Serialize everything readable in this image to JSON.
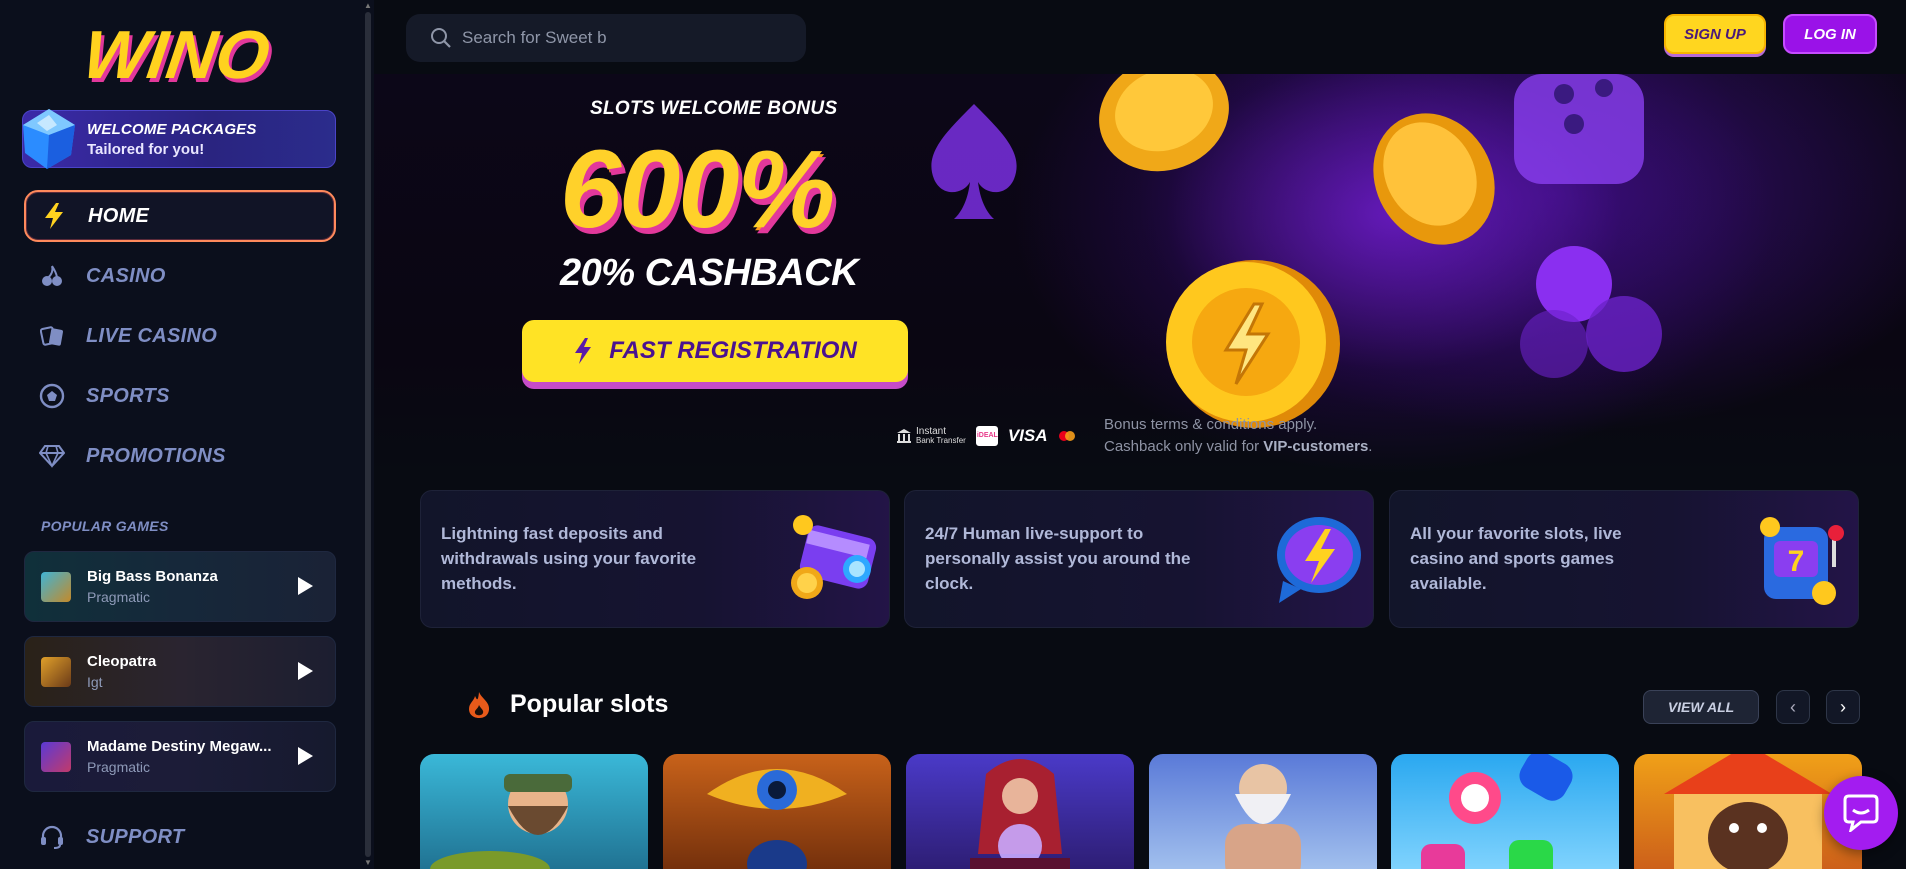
{
  "brand": {
    "logo_text": "WINO"
  },
  "sidebar": {
    "welcome": {
      "title": "WELCOME PACKAGES",
      "subtitle": "Tailored for you!"
    },
    "nav": [
      {
        "label": "HOME",
        "icon": "lightning-icon",
        "active": true
      },
      {
        "label": "CASINO",
        "icon": "cherries-icon",
        "active": false
      },
      {
        "label": "LIVE CASINO",
        "icon": "cards-icon",
        "active": false
      },
      {
        "label": "SPORTS",
        "icon": "soccer-ball-icon",
        "active": false
      },
      {
        "label": "PROMOTIONS",
        "icon": "diamond-icon",
        "active": false
      }
    ],
    "popular_title": "POPULAR GAMES",
    "games": [
      {
        "name": "Big Bass Bonanza",
        "provider": "Pragmatic"
      },
      {
        "name": "Cleopatra",
        "provider": "Igt"
      },
      {
        "name": "Madame Destiny Megaw...",
        "provider": "Pragmatic"
      }
    ],
    "support": {
      "label": "SUPPORT",
      "icon": "headset-icon"
    }
  },
  "header": {
    "search": {
      "prefix": "Search for",
      "value": "Sweet b",
      "icon": "search-icon"
    },
    "signup_label": "SIGN UP",
    "login_label": "LOG IN"
  },
  "hero": {
    "kicker": "SLOTS WELCOME BONUS",
    "headline": "600%",
    "cashback": "20% CASHBACK",
    "cta_label": "FAST REGISTRATION",
    "payments": {
      "bank_line1": "Instant",
      "bank_line2": "Bank Transfer",
      "ideal": "iDEAL",
      "visa": "VISA"
    },
    "terms_line1": "Bonus terms & conditions apply.",
    "terms_line2_prefix": "Cashback only valid for ",
    "terms_line2_strong": "VIP-customers",
    "terms_line2_suffix": "."
  },
  "features": [
    {
      "text": "Lightning fast deposits and withdrawals using your favorite methods.",
      "icon": "wallet-coins-icon"
    },
    {
      "text": "24/7 Human live-support to personally assist you around the clock.",
      "icon": "lightning-chat-icon"
    },
    {
      "text": "All your favorite slots, live casino and sports games available.",
      "icon": "slot-machine-icon"
    }
  ],
  "popular_slots": {
    "title": "Popular slots",
    "view_all_label": "VIEW ALL",
    "prev_icon": "chevron-left-icon",
    "next_icon": "chevron-right-icon",
    "prev_glyph": "‹",
    "next_glyph": "›"
  },
  "chat": {
    "icon": "chat-bubble-icon"
  },
  "colors": {
    "accent_yellow": "#ffd61f",
    "accent_purple": "#9a12e8",
    "nav_inactive": "#7f8ec4",
    "active_border": "#ff8a5c",
    "background": "#080b12"
  }
}
